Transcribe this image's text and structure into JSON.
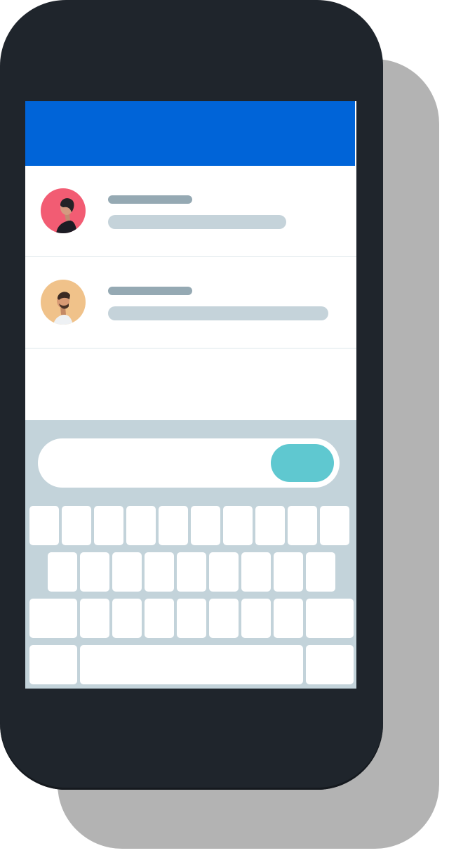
{
  "colors": {
    "phone_body": "#1f252c",
    "header_bar": "#0064d8",
    "keyboard_background": "#c3d3da",
    "send_button": "#5fc8d0",
    "avatar_1_background": "#f25c73",
    "avatar_2_background": "#f0c28a",
    "placeholder_title": "#95a9b3",
    "placeholder_subtitle": "#c5d3da"
  },
  "contacts": [
    {
      "avatar": "woman-profile-avatar",
      "title_text": "",
      "subtitle_text": ""
    },
    {
      "avatar": "man-profile-avatar",
      "title_text": "",
      "subtitle_text": ""
    }
  ],
  "message_input": {
    "value": "",
    "placeholder": ""
  },
  "keyboard": {
    "rows": [
      {
        "key_count": 10
      },
      {
        "key_count": 9
      },
      {
        "key_count": 9
      },
      {
        "key_count": 3
      }
    ]
  }
}
